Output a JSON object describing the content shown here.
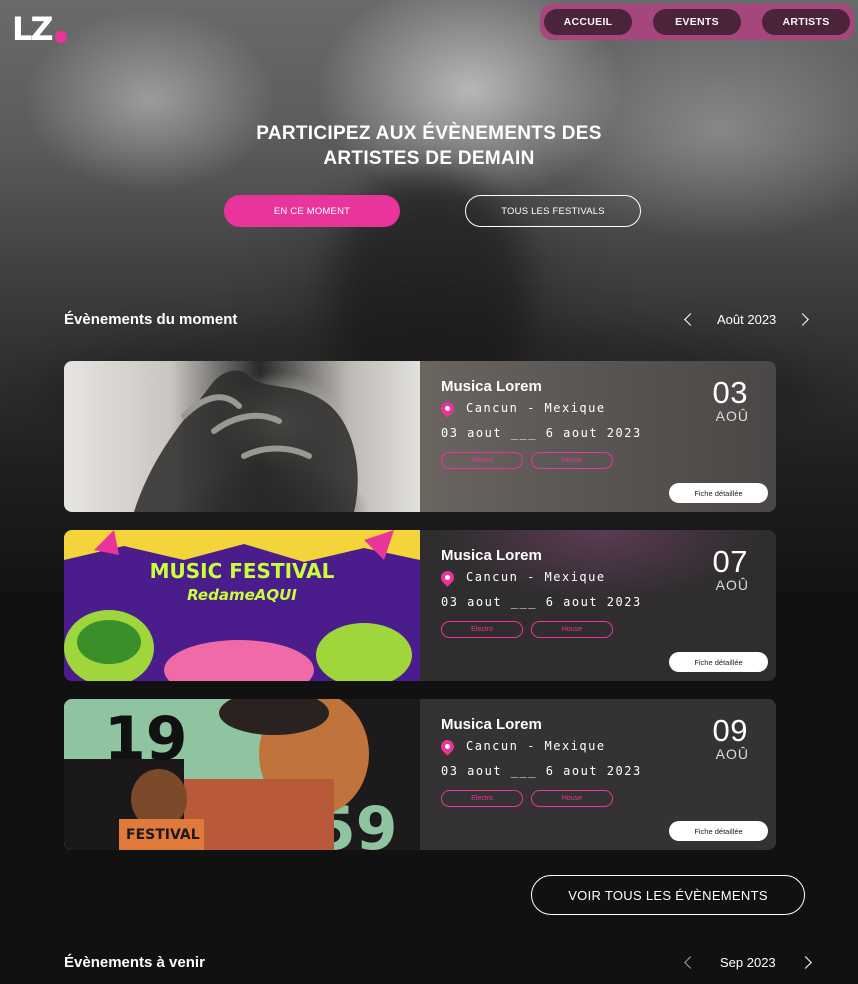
{
  "logo": {
    "text": "LZ"
  },
  "nav": {
    "items": [
      {
        "label": "ACCUEIL"
      },
      {
        "label": "EVENTS"
      },
      {
        "label": "ARTISTS"
      }
    ]
  },
  "hero": {
    "title_line1": "PARTICIPEZ AUX ÉVÈNEMENTS DES",
    "title_line2": "ARTISTES DE DEMAIN",
    "primary_button": "EN CE MOMENT",
    "secondary_button": "TOUS LES FESTIVALS"
  },
  "current": {
    "title": "Évènements du moment",
    "month": "Août 2023",
    "events": [
      {
        "name": "Musica Lorem",
        "location": "Cancun - Mexique",
        "dates": "03 aout ___ 6 aout 2023",
        "tags": [
          "Electro",
          "House"
        ],
        "day": "03",
        "month": "AOÛ",
        "cta": "Fiche détaillée"
      },
      {
        "name": "Musica Lorem",
        "location": "Cancun - Mexique",
        "dates": "03 aout ___ 6 aout 2023",
        "tags": [
          "Electro",
          "House"
        ],
        "day": "07",
        "month": "AOÛ",
        "cta": "Fiche détaillée"
      },
      {
        "name": "Musica Lorem",
        "location": "Cancun - Mexique",
        "dates": "03 aout ___ 6 aout 2023",
        "tags": [
          "Electro",
          "House"
        ],
        "day": "09",
        "month": "AOÛ",
        "cta": "Fiche détaillée"
      }
    ],
    "poster_text": {
      "line1": "MUSIC FESTIVAL",
      "line2": "RedameAQUI"
    },
    "poster3_text": {
      "year_a": "19",
      "year_b": "59",
      "banner": "FESTIVAL"
    },
    "see_all": "VOIR TOUS LES ÉVÈNEMENTS"
  },
  "upcoming": {
    "title": "Évènements à venir",
    "month": "Sep 2023"
  },
  "colors": {
    "accent": "#e8349b",
    "background": "#121111",
    "card": "#2f2d2e",
    "nav": "#a9457f"
  }
}
